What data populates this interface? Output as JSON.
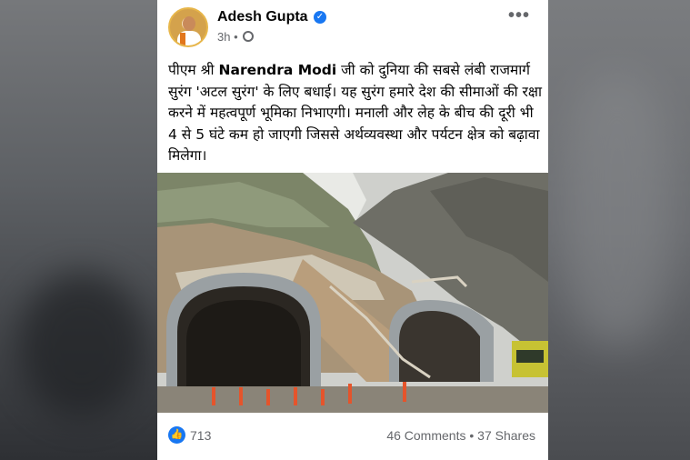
{
  "post": {
    "author": "Adesh Gupta",
    "time": "3h",
    "separator": "•",
    "text_prefix": "पीएम श्री ",
    "text_bold": "Narendra Modi",
    "text_rest": " जी को दुनिया की सबसे लंबी राजमार्ग सुरंग 'अटल सुरंग' के लिए बधाई। यह सुरंग हमारे देश की सीमाओं की रक्षा करने में महत्वपूर्ण भूमिका निभाएगी। मनाली और लेह के बीच की दूरी भी 4 से 5 घंटे कम हो जाएगी जिससे अर्थव्यवस्था और पर्यटन क्षेत्र को बढ़ावा मिलेगा।",
    "likes": "713",
    "comments": "46 Comments",
    "shares": "37 Shares",
    "stats_sep": " • "
  },
  "icons": {
    "verified": "verified-badge-icon",
    "globe": "globe-icon",
    "more": "more-options-icon",
    "like": "like-reaction-icon"
  },
  "colors": {
    "accent": "#1877f2",
    "secondary_text": "#65676b",
    "primary_text": "#050505"
  }
}
